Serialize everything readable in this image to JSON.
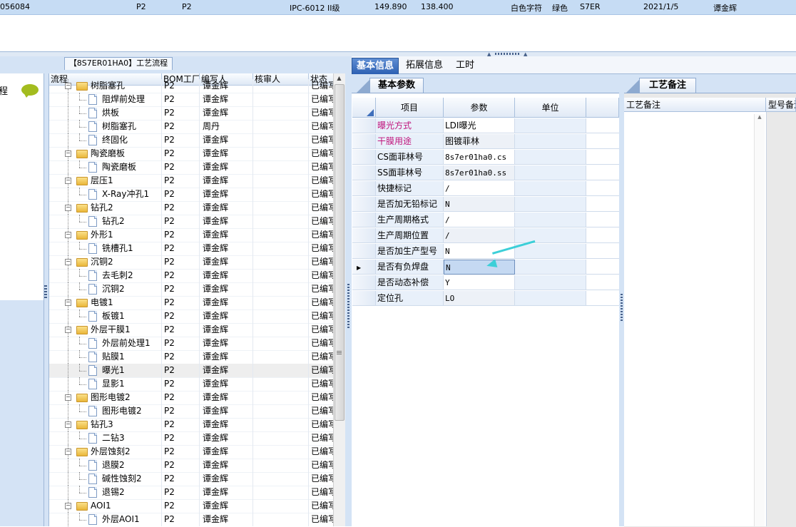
{
  "top_row": [
    "056084",
    "P2",
    "P2",
    "IPC-6012 II级",
    "149.890",
    "138.400",
    "白色字符",
    "绿色",
    "S7ER",
    "2021/1/5",
    "谭金辉"
  ],
  "left_panel": {
    "caption": "【8S7ER01HA0】工艺流程",
    "small_label": "程",
    "columns": [
      "流程",
      "BOM工厂",
      "编写人",
      "核审人",
      "状态"
    ],
    "rows": [
      {
        "name": "树脂塞孔",
        "level": 0,
        "factory": "P2",
        "writer": "谭金辉",
        "reviewer": "",
        "status": "已编写"
      },
      {
        "name": "阻焊前处理",
        "level": 1,
        "factory": "P2",
        "writer": "谭金辉",
        "reviewer": "",
        "status": "已编写"
      },
      {
        "name": "烘板",
        "level": 1,
        "factory": "P2",
        "writer": "谭金辉",
        "reviewer": "",
        "status": "已编写"
      },
      {
        "name": "树脂塞孔",
        "level": 1,
        "factory": "P2",
        "writer": "周丹",
        "reviewer": "",
        "status": "已编写"
      },
      {
        "name": "终固化",
        "level": 1,
        "factory": "P2",
        "writer": "谭金辉",
        "reviewer": "",
        "status": "已编写"
      },
      {
        "name": "陶瓷磨板",
        "level": 0,
        "factory": "P2",
        "writer": "谭金辉",
        "reviewer": "",
        "status": "已编写"
      },
      {
        "name": "陶瓷磨板",
        "level": 1,
        "factory": "P2",
        "writer": "谭金辉",
        "reviewer": "",
        "status": "已编写"
      },
      {
        "name": "层压1",
        "level": 0,
        "factory": "P2",
        "writer": "谭金辉",
        "reviewer": "",
        "status": "已编写"
      },
      {
        "name": "X-Ray冲孔1",
        "level": 1,
        "factory": "P2",
        "writer": "谭金辉",
        "reviewer": "",
        "status": "已编写"
      },
      {
        "name": "钻孔2",
        "level": 0,
        "factory": "P2",
        "writer": "谭金辉",
        "reviewer": "",
        "status": "已编写"
      },
      {
        "name": "钻孔2",
        "level": 1,
        "factory": "P2",
        "writer": "谭金辉",
        "reviewer": "",
        "status": "已编写"
      },
      {
        "name": "外形1",
        "level": 0,
        "factory": "P2",
        "writer": "谭金辉",
        "reviewer": "",
        "status": "已编写"
      },
      {
        "name": "铣槽孔1",
        "level": 1,
        "factory": "P2",
        "writer": "谭金辉",
        "reviewer": "",
        "status": "已编写"
      },
      {
        "name": "沉铜2",
        "level": 0,
        "factory": "P2",
        "writer": "谭金辉",
        "reviewer": "",
        "status": "已编写"
      },
      {
        "name": "去毛刺2",
        "level": 1,
        "factory": "P2",
        "writer": "谭金辉",
        "reviewer": "",
        "status": "已编写"
      },
      {
        "name": "沉铜2",
        "level": 1,
        "factory": "P2",
        "writer": "谭金辉",
        "reviewer": "",
        "status": "已编写"
      },
      {
        "name": "电镀1",
        "level": 0,
        "factory": "P2",
        "writer": "谭金辉",
        "reviewer": "",
        "status": "已编写"
      },
      {
        "name": "板镀1",
        "level": 1,
        "factory": "P2",
        "writer": "谭金辉",
        "reviewer": "",
        "status": "已编写"
      },
      {
        "name": "外层干膜1",
        "level": 0,
        "factory": "P2",
        "writer": "谭金辉",
        "reviewer": "",
        "status": "已编写"
      },
      {
        "name": "外层前处理1",
        "level": 1,
        "factory": "P2",
        "writer": "谭金辉",
        "reviewer": "",
        "status": "已编写"
      },
      {
        "name": "贴膜1",
        "level": 1,
        "factory": "P2",
        "writer": "谭金辉",
        "reviewer": "",
        "status": "已编写"
      },
      {
        "name": "曝光1",
        "level": 1,
        "factory": "P2",
        "writer": "谭金辉",
        "reviewer": "",
        "status": "已编写",
        "selected": true
      },
      {
        "name": "显影1",
        "level": 1,
        "factory": "P2",
        "writer": "谭金辉",
        "reviewer": "",
        "status": "已编写"
      },
      {
        "name": "图形电镀2",
        "level": 0,
        "factory": "P2",
        "writer": "谭金辉",
        "reviewer": "",
        "status": "已编写"
      },
      {
        "name": "图形电镀2",
        "level": 1,
        "factory": "P2",
        "writer": "谭金辉",
        "reviewer": "",
        "status": "已编写"
      },
      {
        "name": "钻孔3",
        "level": 0,
        "factory": "P2",
        "writer": "谭金辉",
        "reviewer": "",
        "status": "已编写"
      },
      {
        "name": "二钻3",
        "level": 1,
        "factory": "P2",
        "writer": "谭金辉",
        "reviewer": "",
        "status": "已编写"
      },
      {
        "name": "外层蚀刻2",
        "level": 0,
        "factory": "P2",
        "writer": "谭金辉",
        "reviewer": "",
        "status": "已编写"
      },
      {
        "name": "退膜2",
        "level": 1,
        "factory": "P2",
        "writer": "谭金辉",
        "reviewer": "",
        "status": "已编写"
      },
      {
        "name": "碱性蚀刻2",
        "level": 1,
        "factory": "P2",
        "writer": "谭金辉",
        "reviewer": "",
        "status": "已编写"
      },
      {
        "name": "退锡2",
        "level": 1,
        "factory": "P2",
        "writer": "谭金辉",
        "reviewer": "",
        "status": "已编写"
      },
      {
        "name": "AOI1",
        "level": 0,
        "factory": "P2",
        "writer": "谭金辉",
        "reviewer": "",
        "status": "已编写"
      },
      {
        "name": "外层AOI1",
        "level": 1,
        "factory": "P2",
        "writer": "谭金辉",
        "reviewer": "",
        "status": "已编写"
      }
    ]
  },
  "tabs": [
    "基本信息",
    "拓展信息",
    "工时"
  ],
  "basic_params": {
    "subtab": "基本参数",
    "columns": [
      "项目",
      "参数",
      "单位"
    ],
    "rows": [
      {
        "item": "曝光方式",
        "param": "LDI曝光",
        "unit": "",
        "highlight": true
      },
      {
        "item": "干膜用途",
        "param": "图镀菲林",
        "unit": "",
        "highlight": true
      },
      {
        "item": "CS面菲林号",
        "param": "8s7er01ha0.cs",
        "unit": ""
      },
      {
        "item": "SS面菲林号",
        "param": "8s7er01ha0.ss",
        "unit": ""
      },
      {
        "item": "快捷标记",
        "param": "/",
        "unit": ""
      },
      {
        "item": "是否加无铅标记",
        "param": "N",
        "unit": ""
      },
      {
        "item": "生产周期格式",
        "param": "/",
        "unit": ""
      },
      {
        "item": "生产周期位置",
        "param": "/",
        "unit": ""
      },
      {
        "item": "是否加生产型号",
        "param": "N",
        "unit": ""
      },
      {
        "item": "是否有负焊盘",
        "param": "N",
        "unit": "",
        "selected": true
      },
      {
        "item": "是否动态补偿",
        "param": "Y",
        "unit": ""
      },
      {
        "item": "定位孔",
        "param": "LO",
        "unit": ""
      }
    ]
  },
  "process_notes": {
    "subtab": "工艺备注",
    "columns": [
      "工艺备注",
      "型号备注"
    ]
  },
  "colors": {
    "accent": "#2d60b3",
    "panel": "#d4e3f5",
    "highlight_text": "#c0167d",
    "annotation_arrow": "#3ccfd8"
  }
}
